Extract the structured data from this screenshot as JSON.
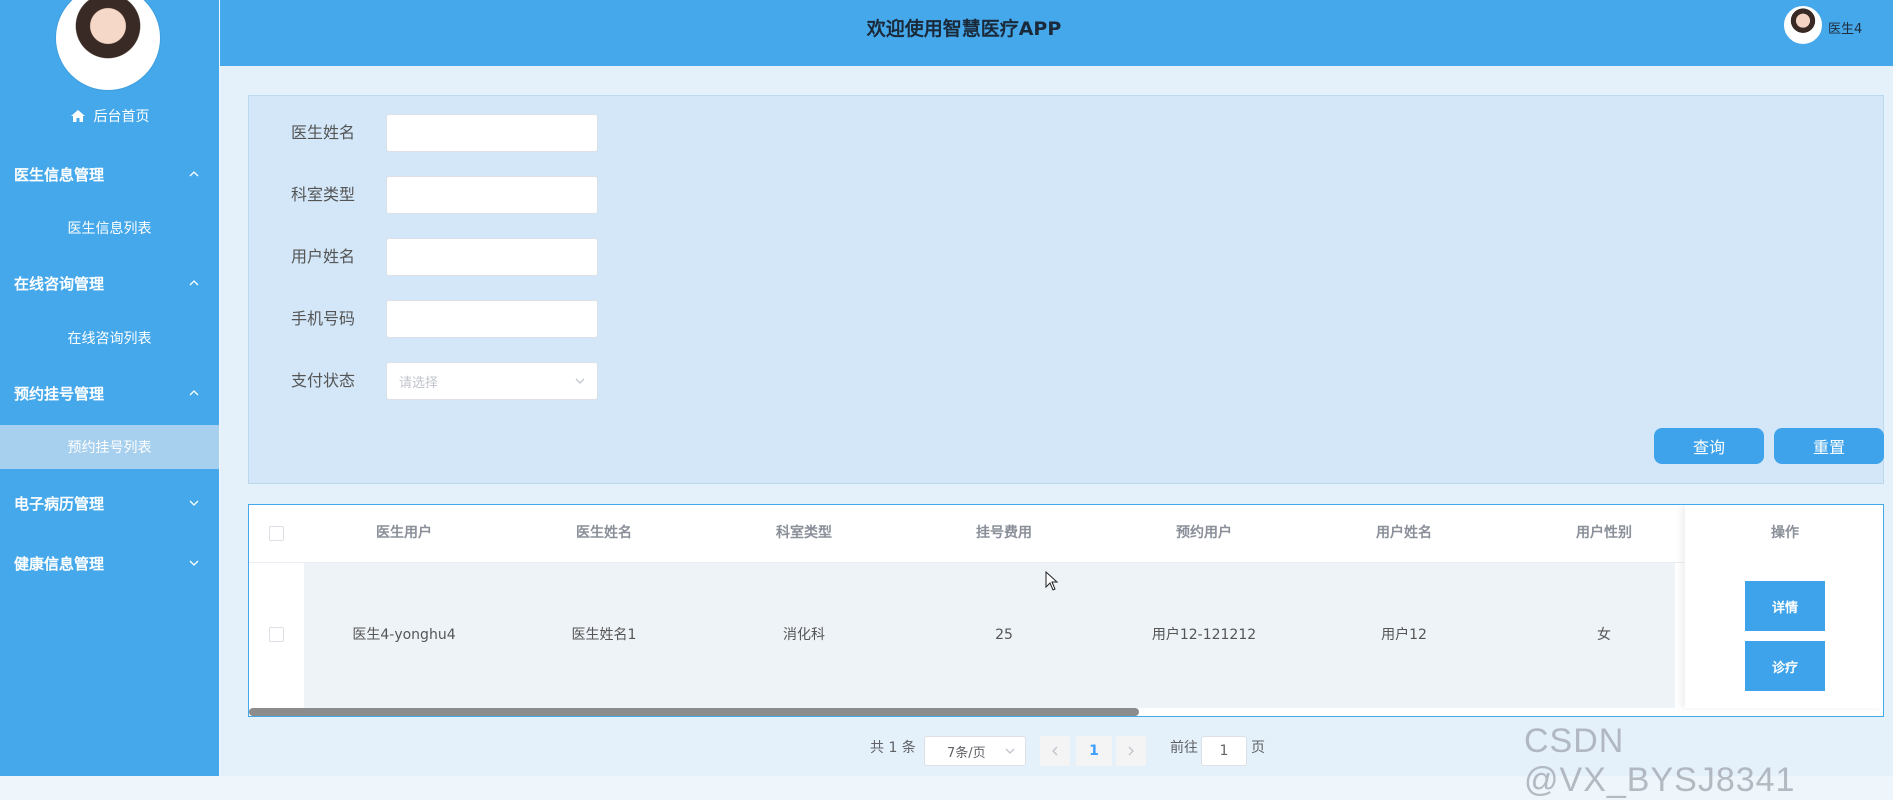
{
  "sidebar": {
    "home_label": "后台首页",
    "groups": [
      {
        "label": "医生信息管理",
        "sub": "医生信息列表"
      },
      {
        "label": "在线咨询管理",
        "sub": "在线咨询列表"
      },
      {
        "label": "预约挂号管理",
        "sub": "预约挂号列表"
      },
      {
        "label": "电子病历管理"
      },
      {
        "label": "健康信息管理"
      }
    ]
  },
  "header": {
    "title": "欢迎使用智慧医疗APP",
    "user_name": "医生4"
  },
  "search": {
    "labels": [
      "医生姓名",
      "科室类型",
      "用户姓名",
      "手机号码",
      "支付状态"
    ],
    "pay_status_placeholder": "请选择",
    "query_button": "查询",
    "reset_button": "重置"
  },
  "table": {
    "columns": [
      "医生用户",
      "医生姓名",
      "科室类型",
      "挂号费用",
      "预约用户",
      "用户姓名",
      "用户性别"
    ],
    "op_header": "操作",
    "rows": [
      {
        "cells": [
          "医生4-yonghu4",
          "医生姓名1",
          "消化科",
          "25",
          "用户12-121212",
          "用户12",
          "女"
        ]
      }
    ],
    "detail_button": "详情",
    "treat_button": "诊疗"
  },
  "pagination": {
    "total": "共 1 条",
    "page_size": "7条/页",
    "current_page": "1",
    "goto_label": "前往",
    "goto_value": "1",
    "page_suffix": "页"
  },
  "watermark": "CSDN @VX_BYSJ8341",
  "colors": {
    "primary": "#45a8eb",
    "button": "#3ea3ea",
    "active_menu": "#a7cfee"
  }
}
